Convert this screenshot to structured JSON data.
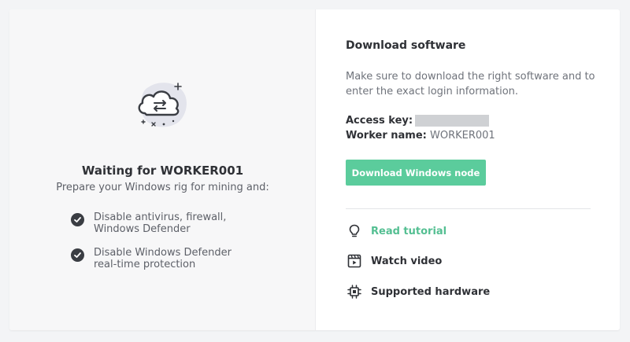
{
  "colors": {
    "accent": "#5bcc9c",
    "accent_text": "#54bf92",
    "panel_bg": "#f7f7f8",
    "redaction": "#cfd1d4"
  },
  "waiting": {
    "icon": "cloud-sync-icon",
    "title": "Waiting for WORKER001",
    "subtitle": "Prepare your Windows rig for mining and:",
    "steps": [
      "Disable antivirus, firewall, Windows Defender",
      "Disable Windows Defender real-time protection"
    ]
  },
  "download": {
    "title": "Download software",
    "description": "Make sure to download the right software and to enter the exact login information.",
    "access_key_label": "Access key:",
    "access_key_value": "",
    "worker_name_label": "Worker name:",
    "worker_name_value": "WORKER001",
    "button_label": "Download Windows node"
  },
  "links": [
    {
      "label": "Read tutorial",
      "icon": "lightbulb-icon"
    },
    {
      "label": "Watch video",
      "icon": "video-player-icon"
    },
    {
      "label": "Supported hardware",
      "icon": "chip-icon"
    }
  ]
}
